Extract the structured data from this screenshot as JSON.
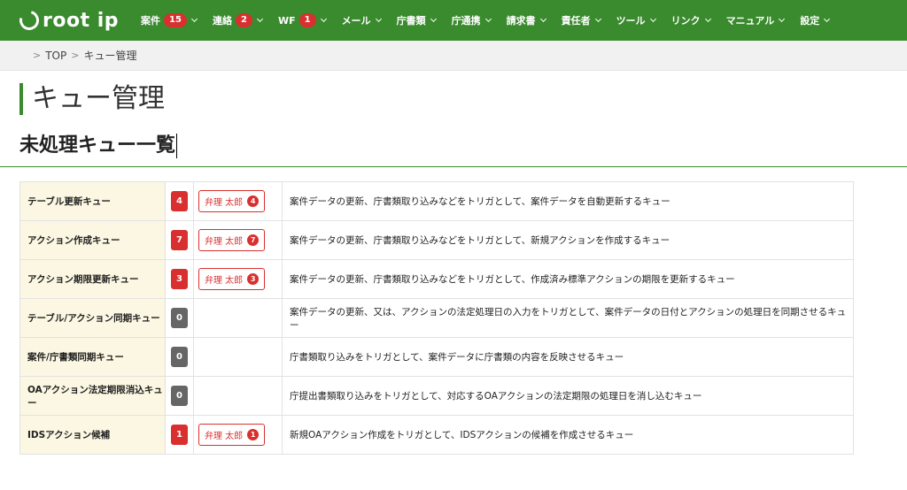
{
  "nav": {
    "logo": "root ip",
    "items": [
      {
        "label": "案件",
        "badge": "15"
      },
      {
        "label": "連絡",
        "badge": "2"
      },
      {
        "label": "WF",
        "badge": "1"
      },
      {
        "label": "メール",
        "badge": null
      },
      {
        "label": "庁書類",
        "badge": null
      },
      {
        "label": "庁通携",
        "badge": null
      },
      {
        "label": "請求書",
        "badge": null
      },
      {
        "label": "責任者",
        "badge": null
      },
      {
        "label": "ツール",
        "badge": null
      },
      {
        "label": "リンク",
        "badge": null
      },
      {
        "label": "マニュアル",
        "badge": null
      },
      {
        "label": "設定",
        "badge": null
      }
    ]
  },
  "breadcrumb": {
    "top": "TOP",
    "current": "キュー管理"
  },
  "page_title": "キュー管理",
  "section_title": "未処理キュー一覧",
  "colors": {
    "brand": "#3a8a2e",
    "badge_red": "#d9302f",
    "badge_grey": "#666666",
    "name_bg": "#fbf7e2"
  },
  "queues": [
    {
      "name": "テーブル更新キュー",
      "count": "4",
      "assignee": "弁理 太郎",
      "assignee_count": "4",
      "description": "案件データの更新、庁書類取り込みなどをトリガとして、案件データを自動更新するキュー"
    },
    {
      "name": "アクション作成キュー",
      "count": "7",
      "assignee": "弁理 太郎",
      "assignee_count": "7",
      "description": "案件データの更新、庁書類取り込みなどをトリガとして、新規アクションを作成するキュー"
    },
    {
      "name": "アクション期限更新キュー",
      "count": "3",
      "assignee": "弁理 太郎",
      "assignee_count": "3",
      "description": "案件データの更新、庁書類取り込みなどをトリガとして、作成済み標準アクションの期限を更新するキュー"
    },
    {
      "name": "テーブル/アクション同期キュー",
      "count": "0",
      "assignee": null,
      "assignee_count": null,
      "description": "案件データの更新、又は、アクションの法定処理日の入力をトリガとして、案件データの日付とアクションの処理日を同期させるキュー"
    },
    {
      "name": "案件/庁書類同期キュー",
      "count": "0",
      "assignee": null,
      "assignee_count": null,
      "description": "庁書類取り込みをトリガとして、案件データに庁書類の内容を反映させるキュー"
    },
    {
      "name": "OAアクション法定期限消込キュー",
      "count": "0",
      "assignee": null,
      "assignee_count": null,
      "description": "庁提出書類取り込みをトリガとして、対応するOAアクションの法定期限の処理日を消し込むキュー"
    },
    {
      "name": "IDSアクション候補",
      "count": "1",
      "assignee": "弁理 太郎",
      "assignee_count": "1",
      "description": "新規OAアクション作成をトリガとして、IDSアクションの候補を作成させるキュー"
    }
  ]
}
